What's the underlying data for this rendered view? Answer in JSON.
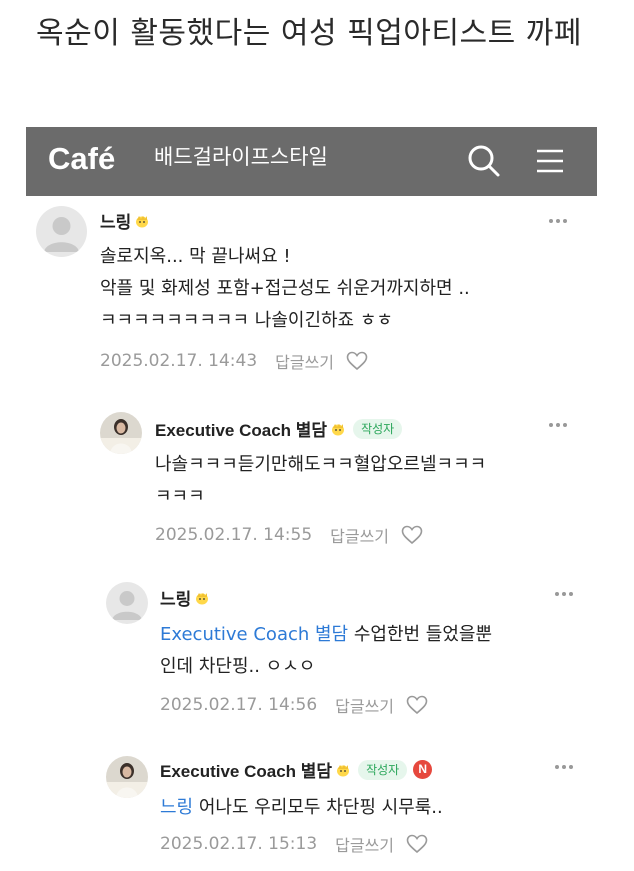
{
  "post": {
    "title": "옥순이 활동했다는 여성 픽업아티스트 까페"
  },
  "header": {
    "logo": "Café",
    "cafe_name": "배드걸라이프스타일",
    "search_icon": "search-icon",
    "menu_icon": "menu-icon"
  },
  "comments": [
    {
      "author": "느링",
      "lines": [
        "솔로지옥... 막 끝나써요 !",
        "악플 및 화제성 포함+접근성도 쉬운거까지하면 ..",
        "ㅋㅋㅋㅋㅋㅋㅋㅋㅋ 나솔이긴하죠 ㅎㅎ"
      ],
      "date": "2025.02.17. 14:43",
      "reply_label": "답글쓰기"
    },
    {
      "author": "Executive Coach 별담",
      "writer_badge": "작성자",
      "lines": [
        "나솔ㅋㅋㅋ듣기만해도ㅋㅋ혈압오르넬ㅋㅋㅋ",
        "ㅋㅋㅋ"
      ],
      "date": "2025.02.17. 14:55",
      "reply_label": "답글쓰기"
    },
    {
      "author": "느링",
      "mention": "Executive Coach 별담",
      "line1_rest": " 수업한번 들었을뿐",
      "line2": "인데 차단핑.. ㅇㅅㅇ",
      "date": "2025.02.17. 14:56",
      "reply_label": "답글쓰기"
    },
    {
      "author": "Executive Coach 별담",
      "writer_badge": "작성자",
      "new_badge": "N",
      "mention": "느링",
      "line1_rest": " 어나도 우리모두 차단핑 시무룩..",
      "date": "2025.02.17. 15:13",
      "reply_label": "답글쓰기"
    }
  ],
  "colors": {
    "header_bg": "#6b6b6b",
    "mention": "#2d7ad6",
    "writer_badge": "#2aa65a",
    "new_badge": "#e6483d"
  }
}
